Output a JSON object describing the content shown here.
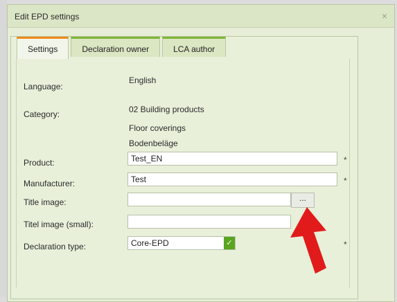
{
  "dialog": {
    "title": "Edit EPD settings",
    "close": "×"
  },
  "tabs": [
    {
      "label": "Settings",
      "active": true
    },
    {
      "label": "Declaration owner",
      "active": false
    },
    {
      "label": "LCA author",
      "active": false
    }
  ],
  "form": {
    "language": {
      "label": "Language:",
      "value": "English"
    },
    "category": {
      "label": "Category:",
      "lines": [
        "02 Building products",
        "Floor coverings",
        "Bodenbeläge"
      ]
    },
    "product": {
      "label": "Product:",
      "value": "Test_EN",
      "required": "*"
    },
    "manufacturer": {
      "label": "Manufacturer:",
      "value": "Test",
      "required": "*"
    },
    "title_image": {
      "label": "Title image:",
      "value": "",
      "browse": "..."
    },
    "title_image_small": {
      "label": "Titel image (small):",
      "value": ""
    },
    "declaration_type": {
      "label": "Declaration type:",
      "value": "Core-EPD",
      "required": "*"
    }
  },
  "colors": {
    "accent_active_tab": "#f08a1a",
    "accent_tab": "#7fb536",
    "select_arrow": "#5aa51f",
    "annotation_arrow": "#e11b1b"
  },
  "icons": {
    "select_arrow": "chevron-down-icon",
    "annotation": "red-arrow-icon"
  }
}
